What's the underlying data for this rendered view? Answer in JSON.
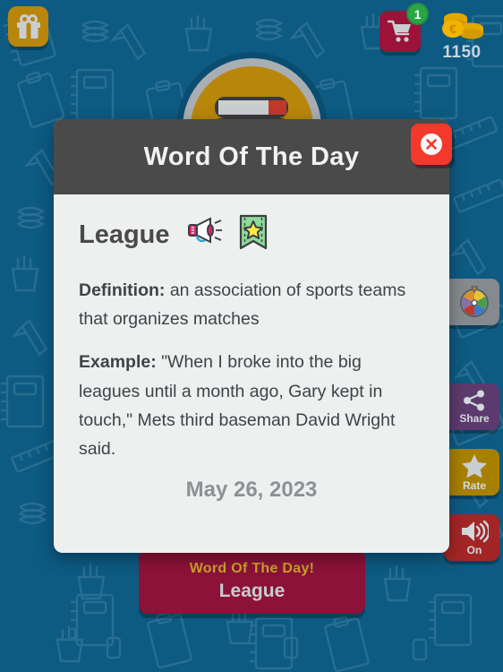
{
  "app": {
    "background_color": "#0d5a82",
    "pattern_color": "#3a7fa3"
  },
  "topbar": {
    "gift_button": {
      "icon": "gift-icon",
      "color": "#b8860b"
    },
    "cart_button": {
      "icon": "shopping-cart-icon",
      "color": "#9c1238",
      "badge": "1",
      "badge_color": "#27a844"
    },
    "coins": {
      "icon": "coins-icon",
      "amount": "1150",
      "color": "#d4a017"
    }
  },
  "logo": {
    "icon": "stacked-books-icon",
    "circle_color": "#b8860b",
    "ring_color": "#a8aeb2"
  },
  "rail": {
    "buttons": [
      {
        "name": "spin-wheel",
        "icon": "spin-wheel-icon",
        "label": "",
        "color": "#848a8e"
      },
      {
        "name": "share",
        "icon": "share-icon",
        "label": "Share",
        "color": "#5d3a6e"
      },
      {
        "name": "rate",
        "icon": "star-icon",
        "label": "Rate",
        "color": "#a88000"
      },
      {
        "name": "sound",
        "icon": "speaker-on-icon",
        "label": "On",
        "color": "#a32626"
      }
    ]
  },
  "banner": {
    "title": "Word Of The Day!",
    "word": "League",
    "bg_color": "#8c1239",
    "title_color": "#c9a227",
    "word_color": "#c7ccd0"
  },
  "modal": {
    "title": "Word Of The Day",
    "header_color": "#4a4a4a",
    "body_color": "#eef0f0",
    "close_button": {
      "icon": "close-x-icon",
      "color": "#f2392c"
    },
    "word": "League",
    "pronounce_icon": "megaphone-icon",
    "bookmark_icon": "bookmark-star-icon",
    "definition_label": "Definition:",
    "definition_text": " an association of sports teams that organizes matches",
    "example_label": "Example:",
    "example_text": " \"When I broke into the big leagues until a month ago, Gary kept in touch,\" Mets third baseman David Wright said.",
    "date": "May 26, 2023"
  }
}
